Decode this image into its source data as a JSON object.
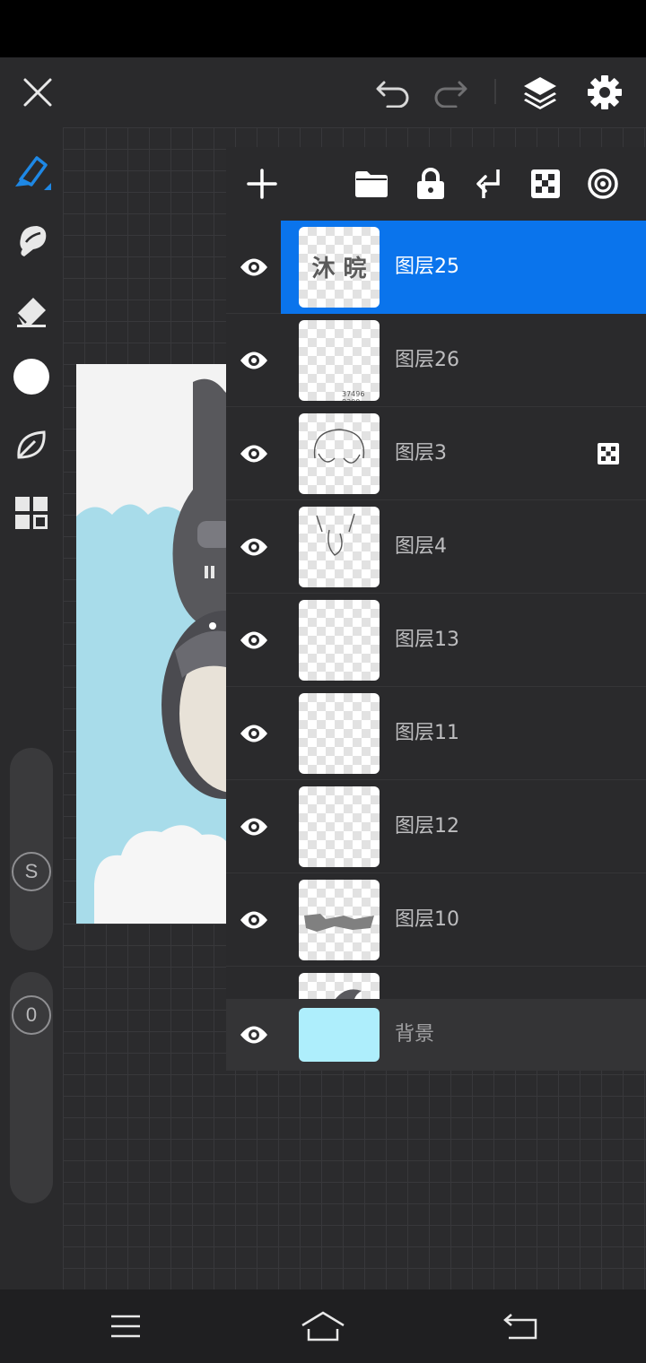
{
  "toolbar": {
    "close": "close-icon",
    "undo": "undo-icon",
    "redo": "redo-icon",
    "layers": "layers-icon",
    "settings": "gear-icon"
  },
  "sidebar": {
    "tools": [
      "brush-icon",
      "smudge-icon",
      "eraser-icon",
      "color-swatch",
      "leaf-icon",
      "grid-icon"
    ],
    "size_label": "S",
    "opacity_label": "0",
    "accent": "#1e88e5"
  },
  "layers_panel": {
    "toolbar": [
      "add-icon",
      "folder-icon",
      "lock-icon",
      "merge-down-icon",
      "alpha-icon",
      "blend-icon"
    ],
    "layers": [
      {
        "name": "图层25",
        "selected": true,
        "thumb_text": "沐 晥"
      },
      {
        "name": "图层26",
        "selected": false,
        "thumb_text": "37496 8300"
      },
      {
        "name": "图层3",
        "selected": false,
        "alpha_locked": true
      },
      {
        "name": "图层4",
        "selected": false
      },
      {
        "name": "图层13",
        "selected": false
      },
      {
        "name": "图层11",
        "selected": false
      },
      {
        "name": "图层12",
        "selected": false
      },
      {
        "name": "图层10",
        "selected": false
      }
    ],
    "background": {
      "name": "背景",
      "color": "#aeeefc"
    },
    "selected_color": "#0a74ec"
  },
  "nav": [
    "menu-icon",
    "home-icon",
    "back-icon"
  ]
}
